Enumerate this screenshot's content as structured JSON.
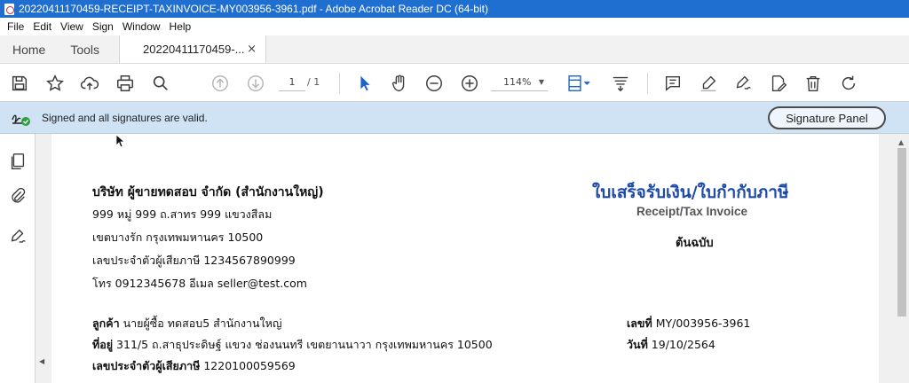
{
  "window": {
    "title": "20220411170459-RECEIPT-TAXINVOICE-MY003956-3961.pdf - Adobe Acrobat Reader DC (64-bit)"
  },
  "menu": [
    "File",
    "Edit",
    "View",
    "Sign",
    "Window",
    "Help"
  ],
  "tabs": {
    "home": "Home",
    "tools": "Tools",
    "document": "20220411170459-...",
    "close": "×"
  },
  "toolbar": {
    "page_current": "1",
    "page_total": "/  1",
    "zoom": "114%",
    "zoom_caret": "▼"
  },
  "signature_bar": {
    "message": "Signed and all signatures are valid.",
    "panel_button": "Signature Panel"
  },
  "document": {
    "seller": {
      "name": "บริษัท ผู้ขายทดสอบ จำกัด (สำนักงานใหญ่)",
      "lines": [
        "999 หมู่ 999 ถ.สาทร 999 แขวงสีลม",
        "เขตบางรัก  กรุงเทพมหานคร 10500",
        "เลขประจำตัวผู้เสียภาษี 1234567890999",
        "โทร 0912345678  อีเมล seller@test.com"
      ]
    },
    "title_th": "ใบเสร็จรับเงิน/ใบกำกับภาษี",
    "title_en": "Receipt/Tax Invoice",
    "copy_label": "ต้นฉบับ",
    "buyer": {
      "customer_label": "ลูกค้า",
      "customer_value": " นายผู้ซื้อ ทดสอบ5 สำนักงานใหญ่",
      "address_label": "ที่อยู่",
      "address_value": " 311/5 ถ.สาธุประดิษฐ์ แขวง ช่องนนทรี เขตยานนาวา กรุงเทพมหานคร  10500",
      "taxid_label": "เลขประจำตัวผู้เสียภาษี",
      "taxid_value": " 1220100059569"
    },
    "meta": {
      "number_label": "เลขที่",
      "number_value": " MY/003956-3961",
      "date_label": "วันที่",
      "date_value": " 19/10/2564"
    }
  },
  "colors": {
    "titlebar": "#1f6fd0",
    "signature_bar": "#cfe3f5",
    "doc_title": "#1d4aa8",
    "toolbar_blue": "#1b62c9"
  }
}
